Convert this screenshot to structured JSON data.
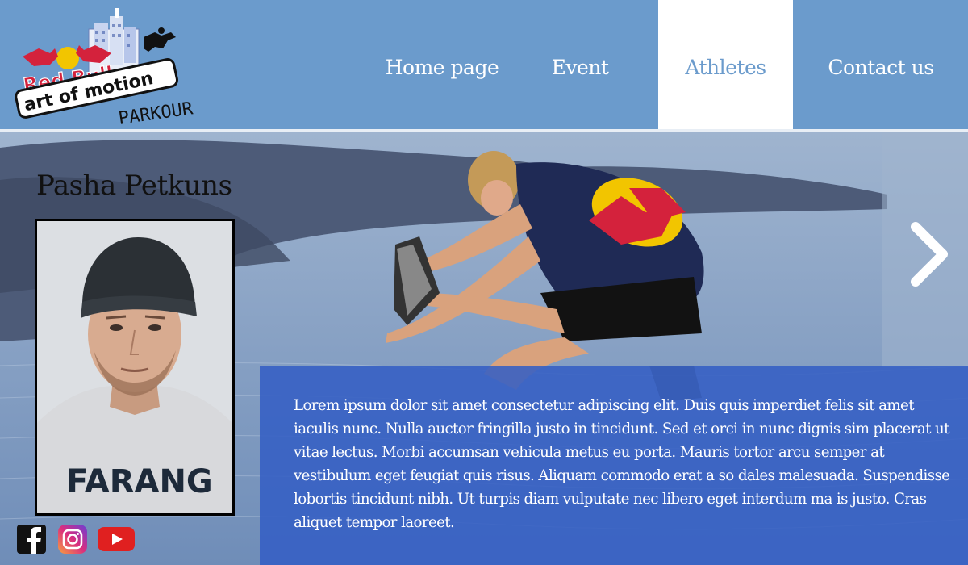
{
  "brand": {
    "logo_text_1": "Red Bull",
    "logo_text_2": "art of motion",
    "logo_text_3": "PARKOUR"
  },
  "nav": {
    "home": "Home page",
    "event": "Event",
    "athletes": "Athletes",
    "contact": "Contact us",
    "active": "Athletes"
  },
  "athlete": {
    "name": "Pasha Petkuns",
    "shirt_text": "FARANG",
    "bio": "Lorem ipsum dolor sit amet  consectetur adipiscing elit. Duis quis imperdiet felis  sit amet iaculis nunc. Nulla auctor fringilla justo in tincidunt. Sed et orci in nunc dignis sim placerat ut vitae lectus. Morbi accumsan vehicula metus eu porta. Mauris tortor arcu  semper at vestibulum eget  feugiat quis risus. Aliquam commodo erat a so dales malesuada.  Suspendisse lobortis tincidunt nibh. Ut turpis diam  vulputate nec libero eget  interdum ma  is justo. Cras aliquet tempor laoreet."
  },
  "social": [
    "facebook-icon",
    "instagram-icon",
    "youtube-icon"
  ],
  "colors": {
    "header": "#6b9bcc",
    "text_panel": "#345ec4",
    "active_nav_bg": "#ffffff"
  }
}
